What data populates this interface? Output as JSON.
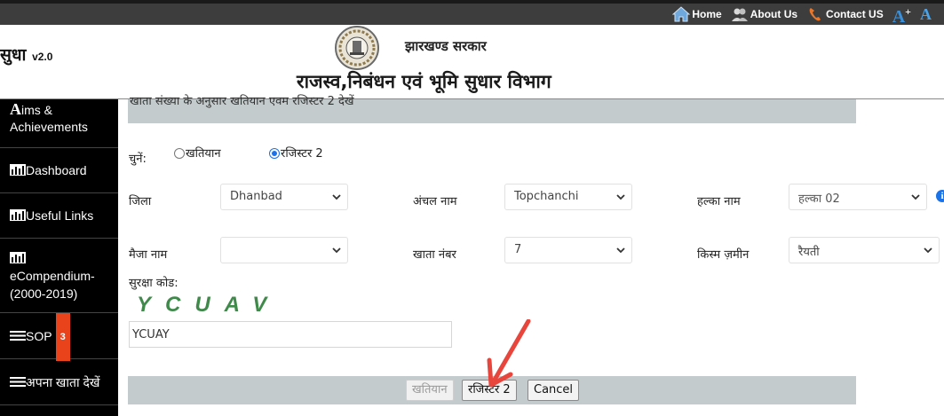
{
  "topnav": {
    "home": "Home",
    "about": "About Us",
    "contact": "Contact US",
    "font_increase": "A",
    "font_increase_plus": "+",
    "font_normal": "A"
  },
  "header": {
    "logo_name": "सुधा",
    "logo_version": "v2.0",
    "gov_title": "झारखण्ड सरकार",
    "dept_title": "राजस्व,निबंधन एवं भूमि सुधार  विभाग"
  },
  "sidebar": {
    "items": [
      {
        "label_initial": "A",
        "label_line1": "ims &",
        "label_line2": "Achievements"
      },
      {
        "label": "Dashboard"
      },
      {
        "label": "Useful Links"
      },
      {
        "label_line1": "eCompendium-",
        "label_line2": "(2000-2019)"
      },
      {
        "label": "SOP",
        "badge": "3"
      },
      {
        "label": "अपना खाता देखें"
      }
    ]
  },
  "form": {
    "info_bar_text": "खाता संख्या के अनुसार खतियान एवम रजिस्टर 2 देखें",
    "choose_label": "चुनें:",
    "radio_khatiyan": "खतियान",
    "radio_register": "रजिस्टर 2",
    "district_label": "जिला",
    "district_value": "Dhanbad",
    "circle_label": "अंचल नाम",
    "circle_value": "Topchanchi",
    "halka_label": "हल्का नाम",
    "halka_value": "हल्का 02",
    "mauza_label": "मैजा नाम",
    "mauza_value": "",
    "khata_label": "खाता नंबर",
    "khata_value": "7",
    "land_type_label": "किस्म ज़मीन",
    "land_type_value": "रैयती",
    "security_code_label": "सुरक्षा कोड:",
    "captcha_text": "YCUAV",
    "captcha_input_value": "YCUAY",
    "btn_khatiyan": "खतियान",
    "btn_register": "रजिस्टर 2",
    "btn_cancel": "Cancel"
  },
  "colors": {
    "topnav_bg": "#3d3d3d",
    "sidebar_bg": "#000000",
    "panel_bar": "#c3cbcc",
    "captcha": "#3f8a4a",
    "arrow": "#e8453c",
    "link_blue": "#1a73e8"
  },
  "icons": [
    "home-icon",
    "users-icon",
    "phone-icon",
    "font-increase-icon",
    "font-reset-icon",
    "emblem-icon",
    "bar-chart-icon",
    "list-icon",
    "info-icon",
    "chevron-down-icon",
    "arrow-annotation-icon"
  ]
}
